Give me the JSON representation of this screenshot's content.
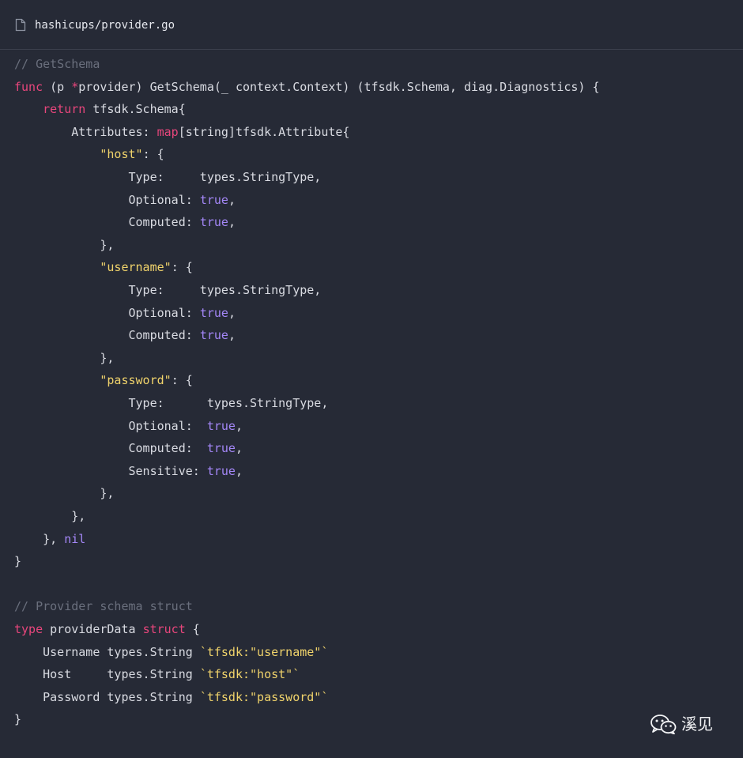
{
  "file": {
    "name": "hashicups/provider.go",
    "icon": "file-icon"
  },
  "code_lines": [
    [
      {
        "t": "// GetSchema",
        "c": "comment"
      }
    ],
    [
      {
        "t": "func",
        "c": "kw"
      },
      {
        "t": " (p ",
        "c": "plain"
      },
      {
        "t": "*",
        "c": "kw"
      },
      {
        "t": "provider) GetSchema(_ context.Context) (tfsdk.Schema, diag.Diagnostics) {",
        "c": "plain"
      }
    ],
    [
      {
        "t": "    ",
        "c": "plain"
      },
      {
        "t": "return",
        "c": "kw"
      },
      {
        "t": " tfsdk.Schema{",
        "c": "plain"
      }
    ],
    [
      {
        "t": "        Attributes: ",
        "c": "plain"
      },
      {
        "t": "map",
        "c": "kw"
      },
      {
        "t": "[string]tfsdk.Attribute{",
        "c": "plain"
      }
    ],
    [
      {
        "t": "            ",
        "c": "plain"
      },
      {
        "t": "\"host\"",
        "c": "str"
      },
      {
        "t": ": {",
        "c": "plain"
      }
    ],
    [
      {
        "t": "                Type:     types.StringType,",
        "c": "plain"
      }
    ],
    [
      {
        "t": "                Optional: ",
        "c": "plain"
      },
      {
        "t": "true",
        "c": "bool"
      },
      {
        "t": ",",
        "c": "plain"
      }
    ],
    [
      {
        "t": "                Computed: ",
        "c": "plain"
      },
      {
        "t": "true",
        "c": "bool"
      },
      {
        "t": ",",
        "c": "plain"
      }
    ],
    [
      {
        "t": "            },",
        "c": "plain"
      }
    ],
    [
      {
        "t": "            ",
        "c": "plain"
      },
      {
        "t": "\"username\"",
        "c": "str"
      },
      {
        "t": ": {",
        "c": "plain"
      }
    ],
    [
      {
        "t": "                Type:     types.StringType,",
        "c": "plain"
      }
    ],
    [
      {
        "t": "                Optional: ",
        "c": "plain"
      },
      {
        "t": "true",
        "c": "bool"
      },
      {
        "t": ",",
        "c": "plain"
      }
    ],
    [
      {
        "t": "                Computed: ",
        "c": "plain"
      },
      {
        "t": "true",
        "c": "bool"
      },
      {
        "t": ",",
        "c": "plain"
      }
    ],
    [
      {
        "t": "            },",
        "c": "plain"
      }
    ],
    [
      {
        "t": "            ",
        "c": "plain"
      },
      {
        "t": "\"password\"",
        "c": "str"
      },
      {
        "t": ": {",
        "c": "plain"
      }
    ],
    [
      {
        "t": "                Type:      types.StringType,",
        "c": "plain"
      }
    ],
    [
      {
        "t": "                Optional:  ",
        "c": "plain"
      },
      {
        "t": "true",
        "c": "bool"
      },
      {
        "t": ",",
        "c": "plain"
      }
    ],
    [
      {
        "t": "                Computed:  ",
        "c": "plain"
      },
      {
        "t": "true",
        "c": "bool"
      },
      {
        "t": ",",
        "c": "plain"
      }
    ],
    [
      {
        "t": "                Sensitive: ",
        "c": "plain"
      },
      {
        "t": "true",
        "c": "bool"
      },
      {
        "t": ",",
        "c": "plain"
      }
    ],
    [
      {
        "t": "            },",
        "c": "plain"
      }
    ],
    [
      {
        "t": "        },",
        "c": "plain"
      }
    ],
    [
      {
        "t": "    }, ",
        "c": "plain"
      },
      {
        "t": "nil",
        "c": "bool"
      }
    ],
    [
      {
        "t": "}",
        "c": "plain"
      }
    ],
    [
      {
        "t": "",
        "c": "plain"
      }
    ],
    [
      {
        "t": "// Provider schema struct",
        "c": "comment"
      }
    ],
    [
      {
        "t": "type",
        "c": "kw"
      },
      {
        "t": " providerData ",
        "c": "plain"
      },
      {
        "t": "struct",
        "c": "kw"
      },
      {
        "t": " {",
        "c": "plain"
      }
    ],
    [
      {
        "t": "    Username types.String ",
        "c": "plain"
      },
      {
        "t": "`tfsdk:\"username\"`",
        "c": "str"
      }
    ],
    [
      {
        "t": "    Host     types.String ",
        "c": "plain"
      },
      {
        "t": "`tfsdk:\"host\"`",
        "c": "str"
      }
    ],
    [
      {
        "t": "    Password types.String ",
        "c": "plain"
      },
      {
        "t": "`tfsdk:\"password\"`",
        "c": "str"
      }
    ],
    [
      {
        "t": "}",
        "c": "plain"
      }
    ]
  ],
  "watermark": {
    "icon": "wechat-icon",
    "text": "溪见"
  },
  "colors": {
    "background": "#262a36",
    "keyword": "#e8467c",
    "string": "#f0d36b",
    "boolean": "#a487f7",
    "comment": "#6a6f7d",
    "plain": "#d9dbe2"
  }
}
